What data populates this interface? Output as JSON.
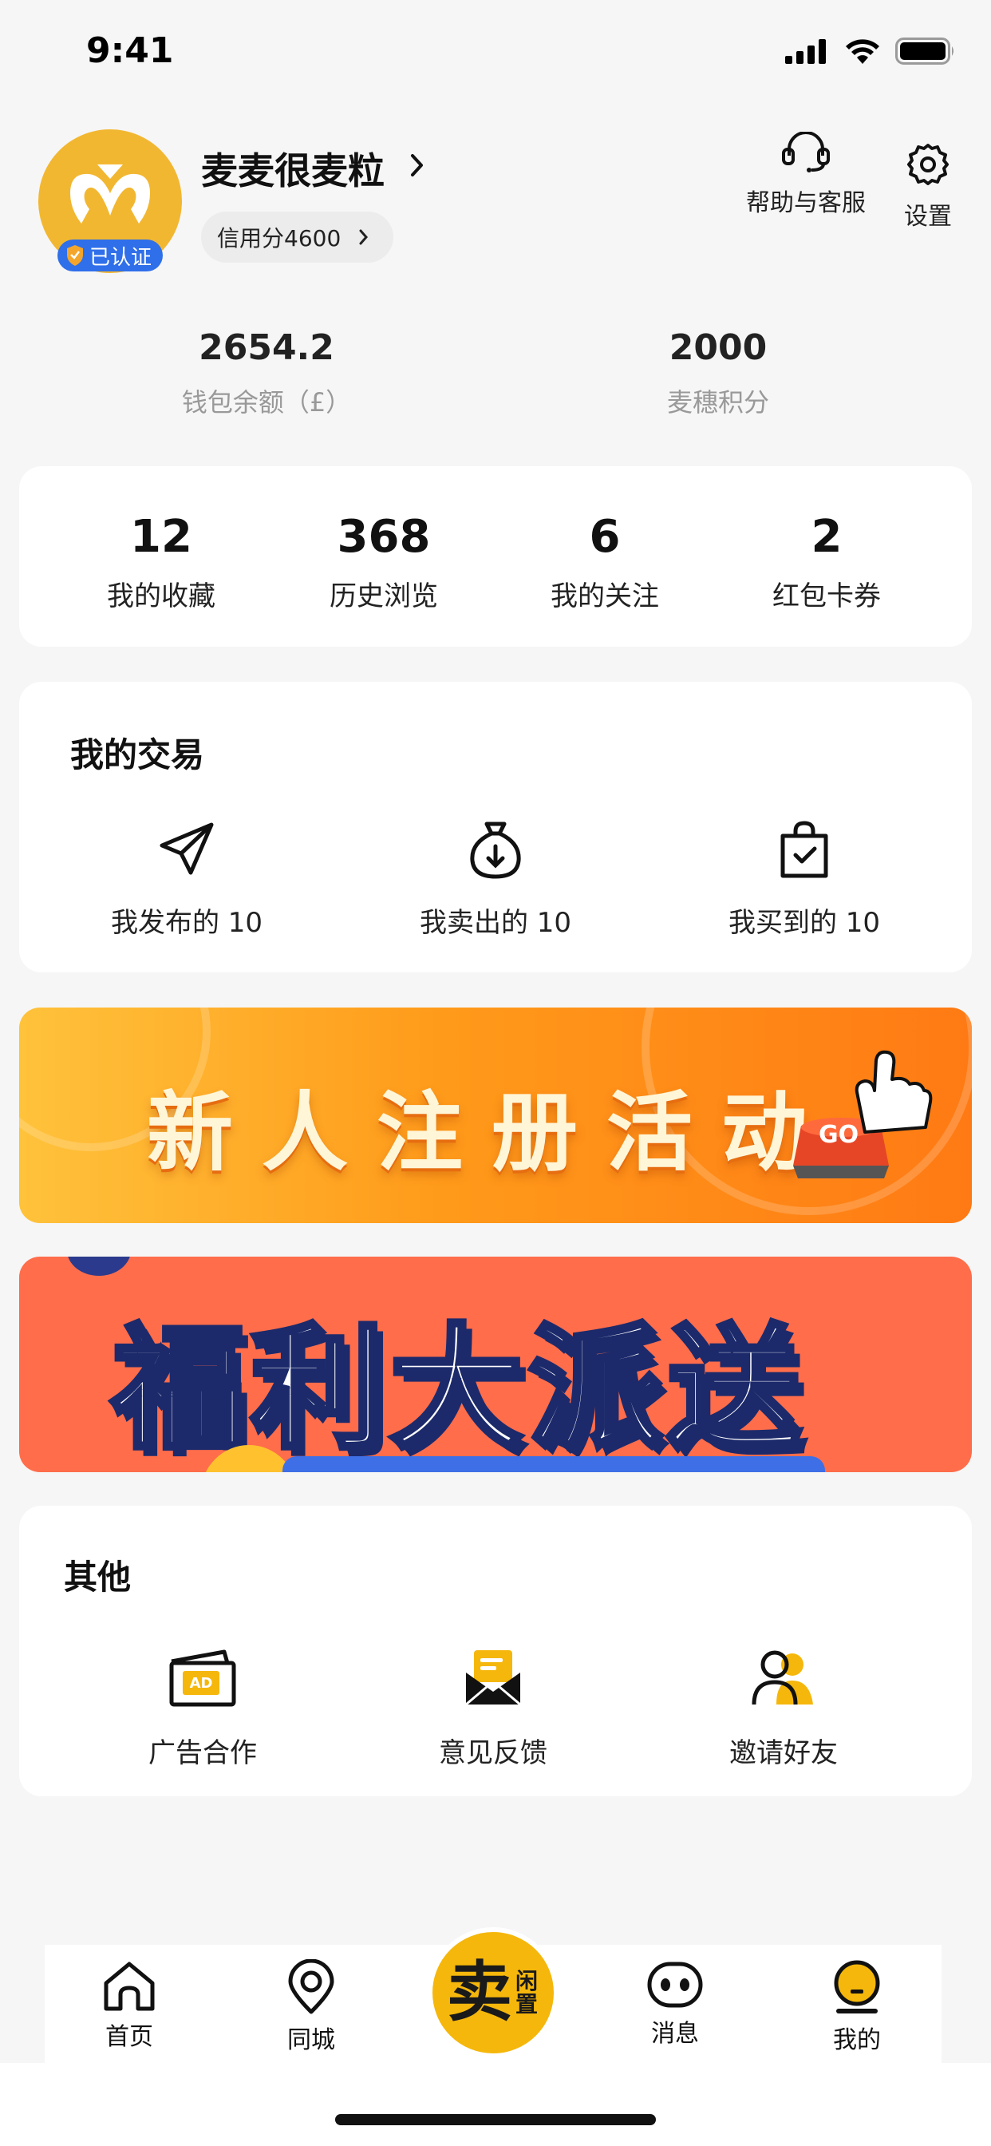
{
  "status_bar": {
    "time": "9:41"
  },
  "profile": {
    "username": "麦麦很麦粒",
    "verified_label": "已认证",
    "credit_label": "信用分4600",
    "help_label": "帮助与客服",
    "settings_label": "设置"
  },
  "wallet": {
    "balance_value": "2654.2",
    "balance_label": "钱包余额（£）",
    "points_value": "2000",
    "points_label": "麦穗积分"
  },
  "stats": [
    {
      "value": "12",
      "label": "我的收藏"
    },
    {
      "value": "368",
      "label": "历史浏览"
    },
    {
      "value": "6",
      "label": "我的关注"
    },
    {
      "value": "2",
      "label": "红包卡券"
    }
  ],
  "trades": {
    "title": "我的交易",
    "items": [
      {
        "label": "我发布的 10",
        "icon": "send-icon"
      },
      {
        "label": "我卖出的 10",
        "icon": "money-bag-icon"
      },
      {
        "label": "我买到的 10",
        "icon": "shopping-bag-icon"
      }
    ]
  },
  "banners": {
    "register_text": "新人注册活动",
    "register_button": "GO",
    "welfare_text": "福利大派送"
  },
  "others": {
    "title": "其他",
    "items": [
      {
        "label": "广告合作",
        "icon": "ad-icon"
      },
      {
        "label": "意见反馈",
        "icon": "feedback-mail-icon"
      },
      {
        "label": "邀请好友",
        "icon": "invite-friends-icon"
      }
    ]
  },
  "tabbar": {
    "home": "首页",
    "local": "同城",
    "sell_main": "卖",
    "sell_sub": "闲置",
    "messages": "消息",
    "mine": "我的"
  },
  "colors": {
    "accent": "#f5b70b",
    "badge_blue": "#2f6fe9",
    "register_orange": "#ff9a1a",
    "welfare_red": "#ff6d4b"
  }
}
